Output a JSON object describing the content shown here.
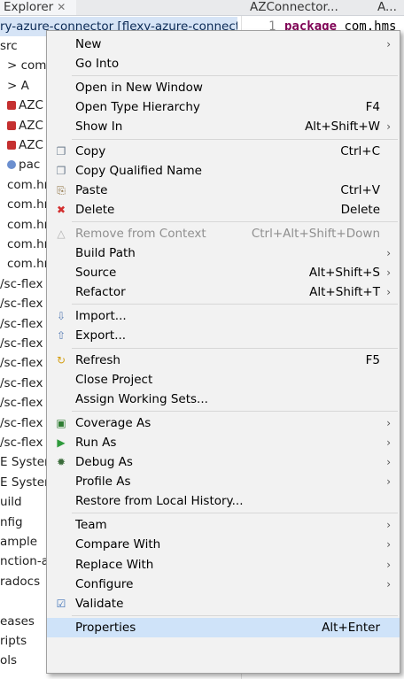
{
  "tabs": [
    {
      "label": "Explorer",
      "active": true,
      "close": "✕"
    },
    {
      "label": "AZConnector..."
    },
    {
      "label": "A..."
    }
  ],
  "tree": {
    "selected_project": "ry-azure-connector [flexy-azure-connector",
    "rows": [
      "src",
      "> com",
      "> A",
      "AZC",
      "AZC",
      "AZC",
      "pac",
      "com.hr",
      "com.hr",
      "com.hr",
      "com.hr",
      "com.hr",
      "/sc-flex",
      "/sc-flex",
      "/sc-flex",
      "/sc-flex",
      "/sc-flex",
      "/sc-flex",
      "/sc-flex",
      "/sc-flex",
      "/sc-flex",
      "E Syster",
      "E Syster",
      "uild",
      "nfig",
      "ample",
      "nction-a",
      "radocs",
      "",
      "eases",
      "ripts",
      "ols"
    ]
  },
  "editor": {
    "line_number": "1",
    "keyword": "package",
    "text": " com.hms"
  },
  "menu": {
    "items": [
      {
        "label": "New",
        "submenu": true
      },
      {
        "label": "Go Into"
      },
      {
        "separator": true
      },
      {
        "label": "Open in New Window"
      },
      {
        "label": "Open Type Hierarchy",
        "accel": "F4"
      },
      {
        "label": "Show In",
        "accel": "Alt+Shift+W",
        "submenu": true
      },
      {
        "separator": true
      },
      {
        "label": "Copy",
        "accel": "Ctrl+C",
        "icon": "copy-icon"
      },
      {
        "label": "Copy Qualified Name",
        "icon": "copy-qualified-icon"
      },
      {
        "label": "Paste",
        "accel": "Ctrl+V",
        "icon": "paste-icon"
      },
      {
        "label": "Delete",
        "accel": "Delete",
        "icon": "delete-icon"
      },
      {
        "separator": true
      },
      {
        "label": "Remove from Context",
        "accel": "Ctrl+Alt+Shift+Down",
        "disabled": true,
        "icon": "remove-context-icon"
      },
      {
        "label": "Build Path",
        "submenu": true
      },
      {
        "label": "Source",
        "accel": "Alt+Shift+S",
        "submenu": true
      },
      {
        "label": "Refactor",
        "accel": "Alt+Shift+T",
        "submenu": true
      },
      {
        "separator": true
      },
      {
        "label": "Import...",
        "icon": "import-icon"
      },
      {
        "label": "Export...",
        "icon": "export-icon"
      },
      {
        "separator": true
      },
      {
        "label": "Refresh",
        "accel": "F5",
        "icon": "refresh-icon"
      },
      {
        "label": "Close Project"
      },
      {
        "label": "Assign Working Sets..."
      },
      {
        "separator": true
      },
      {
        "label": "Coverage As",
        "submenu": true,
        "icon": "coverage-icon"
      },
      {
        "label": "Run As",
        "submenu": true,
        "icon": "run-icon"
      },
      {
        "label": "Debug As",
        "submenu": true,
        "icon": "debug-icon"
      },
      {
        "label": "Profile As",
        "submenu": true
      },
      {
        "label": "Restore from Local History..."
      },
      {
        "separator": true
      },
      {
        "label": "Team",
        "submenu": true
      },
      {
        "label": "Compare With",
        "submenu": true
      },
      {
        "label": "Replace With",
        "submenu": true
      },
      {
        "label": "Configure",
        "submenu": true
      },
      {
        "label": "Validate",
        "icon": "validate-check-icon"
      },
      {
        "separator": true
      },
      {
        "label": "Properties",
        "accel": "Alt+Enter",
        "highlighted": true
      }
    ]
  },
  "colors": {
    "highlight": "#cfe3f9",
    "menu_bg": "#f2f2f2",
    "keyword": "#7f0055",
    "delete_icon": "#d32f2f",
    "run_icon": "#2e9a3b"
  }
}
